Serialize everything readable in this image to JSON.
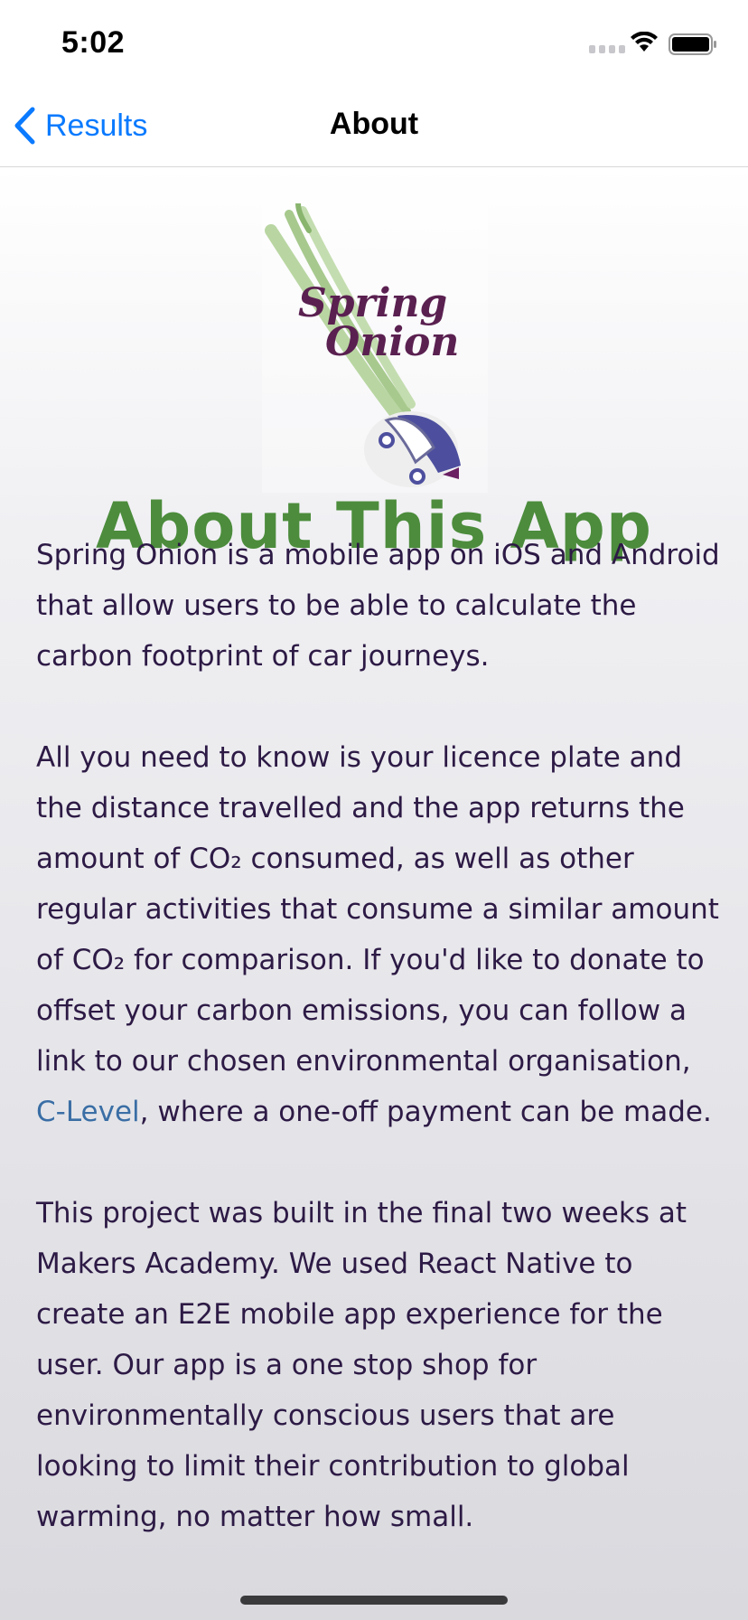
{
  "status_bar": {
    "time": "5:02"
  },
  "nav": {
    "back_label": "Results",
    "title": "About"
  },
  "page": {
    "logo_line1": "Spring",
    "logo_line2": "Onion",
    "heading": "About This App",
    "p1": "Spring Onion is a mobile app on iOS and Android that allow users to be able to calculate the carbon footprint of car journeys.",
    "p2_a": "All you need to know is your licence plate and the distance travelled and the app returns the amount of CO₂ consumed, as well as other regular activities that consume a similar amount of CO₂ for comparison. If you'd like to donate to offset your carbon emissions, you can follow a link to our chosen environmental organisation, ",
    "p2_link": "C-Level",
    "p2_b": ", where a one-off payment can be made.",
    "p3": "This project was built in the final two weeks at Makers Academy. We used React Native to create an E2E mobile app experience for the user. Our app is a one stop shop for environmentally conscious users that are looking to limit their contribution to global warming, no matter how small."
  },
  "colors": {
    "accent": "#0a7aff",
    "heading": "#4c8c3c",
    "text": "#2d1a45",
    "link": "#3a6ea5"
  }
}
